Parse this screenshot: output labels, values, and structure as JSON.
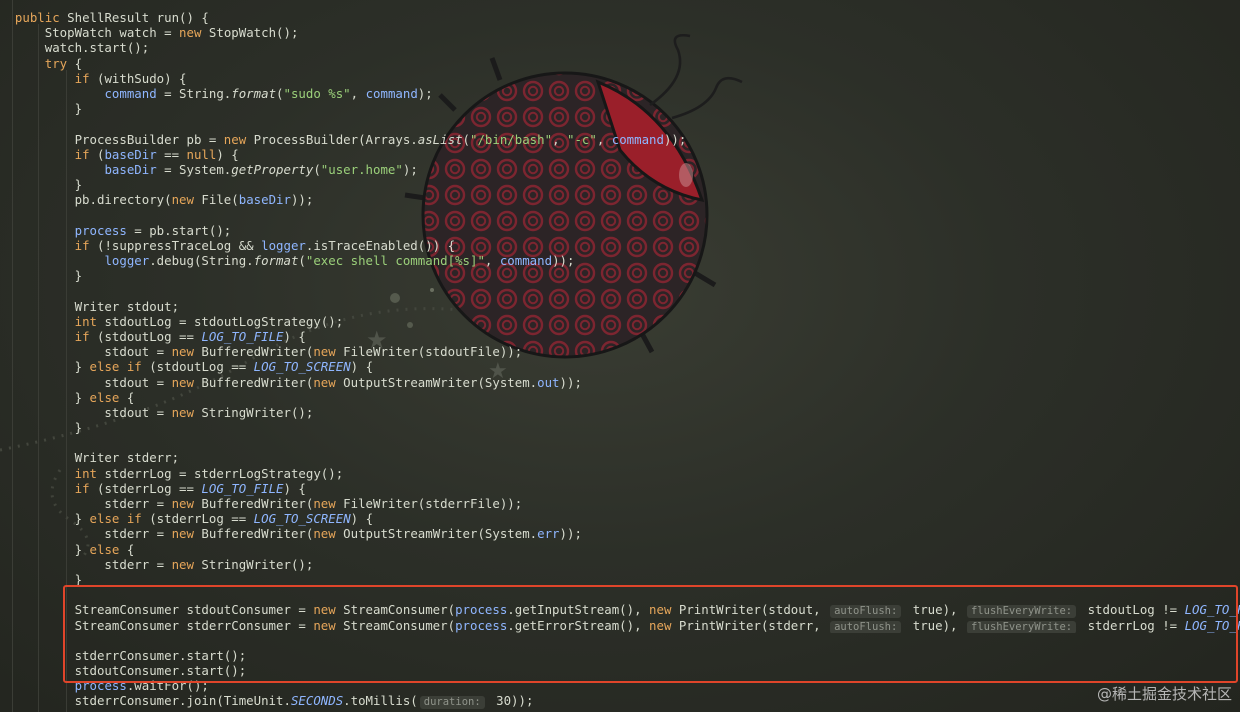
{
  "code_lines": [
    {
      "indent": 2,
      "text": "public ShellResult run() {"
    },
    {
      "indent": 6,
      "text": "StopWatch watch = new StopWatch();"
    },
    {
      "indent": 6,
      "text": "watch.start();"
    },
    {
      "indent": 6,
      "text": "try {"
    },
    {
      "indent": 10,
      "text": "if (withSudo) {"
    },
    {
      "indent": 14,
      "text": "command = String.format(\"sudo %s\", command);"
    },
    {
      "indent": 10,
      "text": "}"
    },
    {
      "indent": 0,
      "text": ""
    },
    {
      "indent": 10,
      "text": "ProcessBuilder pb = new ProcessBuilder(Arrays.asList(\"/bin/bash\", \"-c\", command));"
    },
    {
      "indent": 10,
      "text": "if (baseDir == null) {"
    },
    {
      "indent": 14,
      "text": "baseDir = System.getProperty(\"user.home\");"
    },
    {
      "indent": 10,
      "text": "}"
    },
    {
      "indent": 10,
      "text": "pb.directory(new File(baseDir));"
    },
    {
      "indent": 0,
      "text": ""
    },
    {
      "indent": 10,
      "text": "process = pb.start();"
    },
    {
      "indent": 10,
      "text": "if (!suppressTraceLog && logger.isTraceEnabled()) {"
    },
    {
      "indent": 14,
      "text": "logger.debug(String.format(\"exec shell command[%s]\", command));"
    },
    {
      "indent": 10,
      "text": "}"
    },
    {
      "indent": 0,
      "text": ""
    },
    {
      "indent": 10,
      "text": "Writer stdout;"
    },
    {
      "indent": 10,
      "text": "int stdoutLog = stdoutLogStrategy();"
    },
    {
      "indent": 10,
      "text": "if (stdoutLog == LOG_TO_FILE) {"
    },
    {
      "indent": 14,
      "text": "stdout = new BufferedWriter(new FileWriter(stdoutFile));"
    },
    {
      "indent": 10,
      "text": "} else if (stdoutLog == LOG_TO_SCREEN) {"
    },
    {
      "indent": 14,
      "text": "stdout = new BufferedWriter(new OutputStreamWriter(System.out));"
    },
    {
      "indent": 10,
      "text": "} else {"
    },
    {
      "indent": 14,
      "text": "stdout = new StringWriter();"
    },
    {
      "indent": 10,
      "text": "}"
    },
    {
      "indent": 0,
      "text": ""
    },
    {
      "indent": 10,
      "text": "Writer stderr;"
    },
    {
      "indent": 10,
      "text": "int stderrLog = stderrLogStrategy();"
    },
    {
      "indent": 10,
      "text": "if (stderrLog == LOG_TO_FILE) {"
    },
    {
      "indent": 14,
      "text": "stderr = new BufferedWriter(new FileWriter(stderrFile));"
    },
    {
      "indent": 10,
      "text": "} else if (stderrLog == LOG_TO_SCREEN) {"
    },
    {
      "indent": 14,
      "text": "stderr = new BufferedWriter(new OutputStreamWriter(System.err));"
    },
    {
      "indent": 10,
      "text": "} else {"
    },
    {
      "indent": 14,
      "text": "stderr = new StringWriter();"
    },
    {
      "indent": 10,
      "text": "}"
    },
    {
      "indent": 0,
      "text": ""
    },
    {
      "indent": 10,
      "text": "StreamConsumer stdoutConsumer = new StreamConsumer(process.getInputStream(), new PrintWriter(stdout, [autoFlush:] true), [flushEveryWrite:] stdoutLog != LOG_TO_FILE);"
    },
    {
      "indent": 10,
      "text": "StreamConsumer stderrConsumer = new StreamConsumer(process.getErrorStream(), new PrintWriter(stderr, [autoFlush:] true), [flushEveryWrite:] stderrLog != LOG_TO_FILE);"
    },
    {
      "indent": 0,
      "text": ""
    },
    {
      "indent": 10,
      "text": "stderrConsumer.start();"
    },
    {
      "indent": 10,
      "text": "stdoutConsumer.start();"
    },
    {
      "indent": 10,
      "text": "process.waitFor();"
    },
    {
      "indent": 10,
      "text": "stderrConsumer.join(TimeUnit.SECONDS.toMillis([duration:] 30));"
    }
  ],
  "watermark": "@稀土掘金技术社区",
  "colors": {
    "highlight_border": "#e0452a",
    "keyword": "#e6a65a",
    "field": "#8fb6ff",
    "string": "#9bd07a",
    "text": "#d8dccf"
  }
}
